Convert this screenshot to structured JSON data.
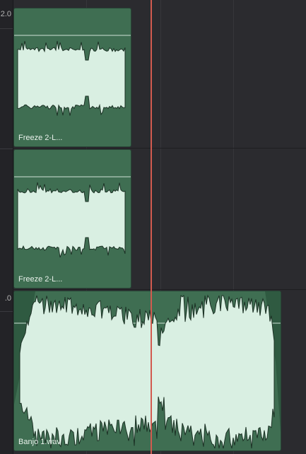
{
  "gutter": {
    "marker_top": "2.0",
    "marker_bottom": ".0"
  },
  "clips": [
    {
      "name": "Freeze 2-L...",
      "kind": "freeze"
    },
    {
      "name": "Freeze 2-L...",
      "kind": "freeze"
    },
    {
      "name": "Banjo 1.wav",
      "kind": "banjo"
    }
  ],
  "colors": {
    "clip_fill": "#3f6e52",
    "waveform": "#d9efe2",
    "playhead": "#d25a4f",
    "background": "#2b2b2f"
  }
}
